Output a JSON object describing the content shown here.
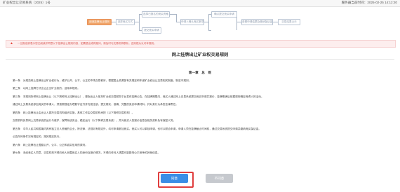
{
  "header": {
    "title": "矿业权出让交易系统（2025）1号",
    "time": "服务器当前时间：2025-02-25 14:12:20"
  },
  "flow": {
    "steps": [
      "阅读挂牌出让规则",
      "选择竞买方式",
      "选择已报名的竞买资格",
      "提交竞买申请",
      "申请人确认竞买事项",
      "确认提交竞买申请",
      "查看申请结果及缴纳保证金",
      "交易结果公示"
    ],
    "active_index": 0
  },
  "alert": {
    "text": "一旦报名即表示您已阅读并同意以下挂牌出让规则内容，如需退出或有疑问，请及时与交易机构联系，否则视为认可本规则。"
  },
  "rules": {
    "title": "网上挂牌出让矿业权交易规则",
    "chapter": "第一章　总　则",
    "paragraphs": [
      "第一条　为规范网上挂牌出让矿业权行为，维护公开、公平、公正的市场交易秩序，根据国土资源部有关规定和本省矿业权出让交易相关制度，制定本规则。",
      "第二条　以网上挂牌方式出让企业矿业权的，适用本规则。",
      "第三条　本规则所称网上挂牌出让（以下简称网上挂牌出让），是指出让人依托矿业权交易服务平台发布挂牌公告，在挂牌期限内，竞买人通过网上交易系统提交竞买申请并报价，挂牌期满后依据规则确定竞得人的活动。",
      "通过网上交易系统参加竞买的申请人，须按照规定办理数字证书并完成注册，提交真实、准确、完整的竞买申请材料，并对其行为承担法律责任。",
      "第四条　网上挂牌出让由出让人委托交易机构组织实施，具体工作由交易机构承担（以下简称交易机构）。",
      "交易机构负责网上交易系统的运行与维护，保障系统安全、稳定运行（以下简称交易系统），并对竞买人的报价信息及相关资料负有保密义务。",
      "第五条　中华人民共和国境内具有独立法人资格的企业，除法律、法规另有规定外，均可申请参加竞买。竞买人可以单独申请，也可以联合申请，申请人须在挂牌截止时间前，通过交易系统提交申请并缴纳竞买保证金。",
      "公告所列条件另有规定的，按其规定执行。",
      "第六条　网上挂牌出让遵循公开、公平、公正和诚实信用的原则。",
      "第七条　未经竞买人同意，交易机构不得向他人泄露竞买人的身份及报价情况，不得向任何人透露可能影响公平竞争的其他信息。"
    ]
  },
  "actions": {
    "agree_label": "同意",
    "disagree_label": "不同意"
  }
}
